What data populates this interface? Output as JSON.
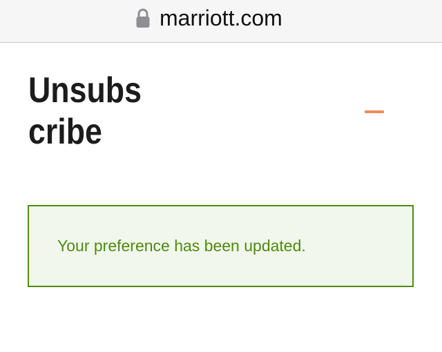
{
  "browser": {
    "url": "marriott.com",
    "lock_icon": "lock-icon"
  },
  "page": {
    "title": "Unsubscribe",
    "menu_icon": "menu-dash-icon",
    "alert": {
      "message": "Your preference has been updated.",
      "status": "success",
      "color": "#4f8a10",
      "background": "#f1f7ec"
    }
  },
  "colors": {
    "accent": "#f08a5d",
    "text": "#1c1c1c"
  }
}
